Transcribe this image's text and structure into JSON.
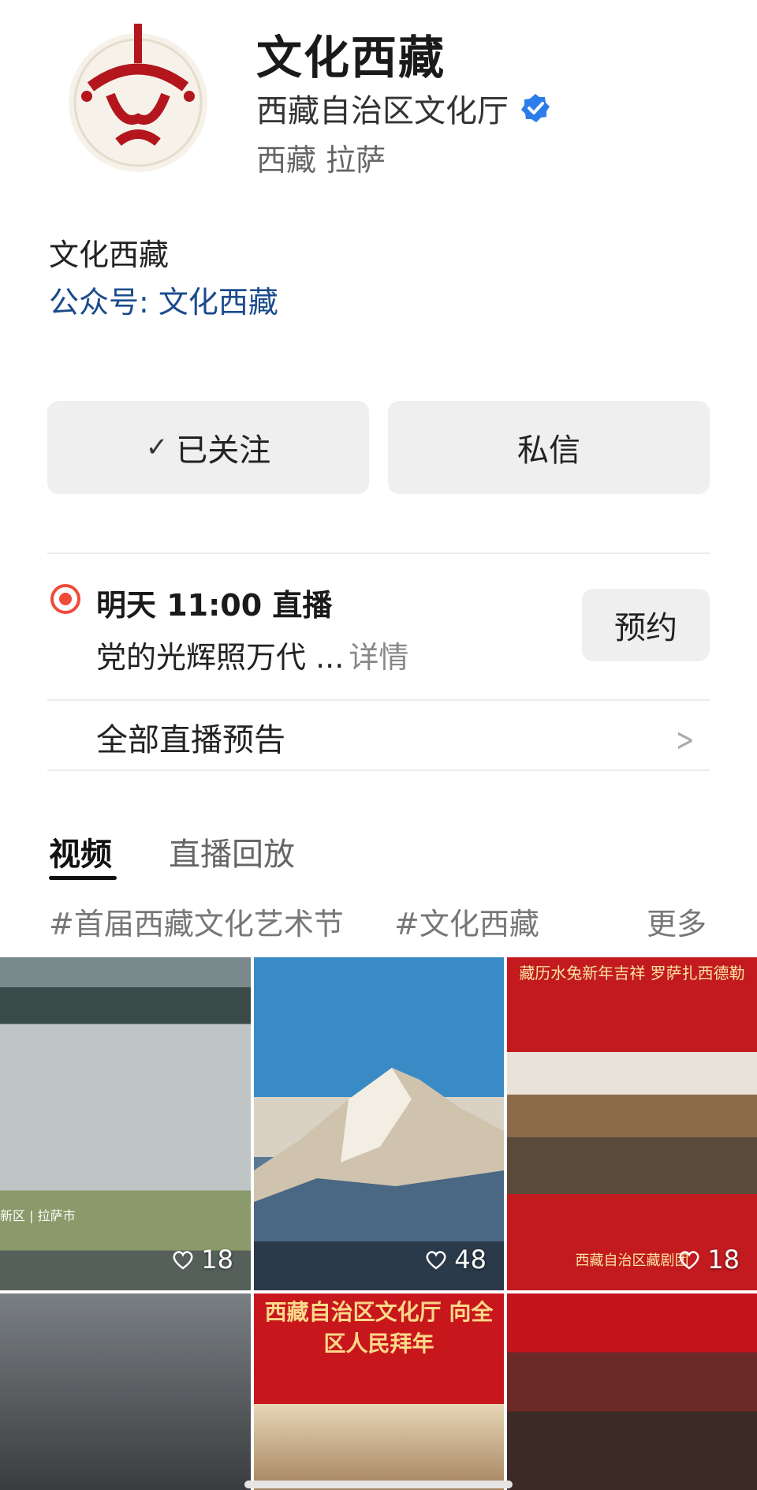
{
  "profile": {
    "name": "文化西藏",
    "organization": "西藏自治区文化厅",
    "location": "西藏 拉萨",
    "bio_name": "文化西藏",
    "official_account": "公众号: 文化西藏",
    "verified_color": "#2b7de9"
  },
  "actions": {
    "follow_label": "已关注",
    "message_label": "私信"
  },
  "live": {
    "time_label": "明天 11:00 直播",
    "title": "党的光辉照万代 ...",
    "detail_label": "详情",
    "reserve_label": "预约",
    "all_previews_label": "全部直播预告",
    "accent_color": "#f04a3a"
  },
  "tabs": [
    {
      "label": "视频",
      "active": true
    },
    {
      "label": "直播回放",
      "active": false
    }
  ],
  "tags": [
    "#首届西藏文化艺术节",
    "#文化西藏",
    "更多"
  ],
  "videos": [
    {
      "likes": "18",
      "overlay": "新区 | 拉萨市"
    },
    {
      "likes": "48"
    },
    {
      "likes": "18",
      "caption_top": "藏历水兔新年吉祥 罗萨扎西德勒",
      "caption_bottom": "西藏自治区藏剧团"
    },
    {
      "likes": ""
    },
    {
      "likes": "",
      "caption_top": "西藏自治区文化厅 向全区人民拜年"
    },
    {
      "likes": ""
    }
  ]
}
